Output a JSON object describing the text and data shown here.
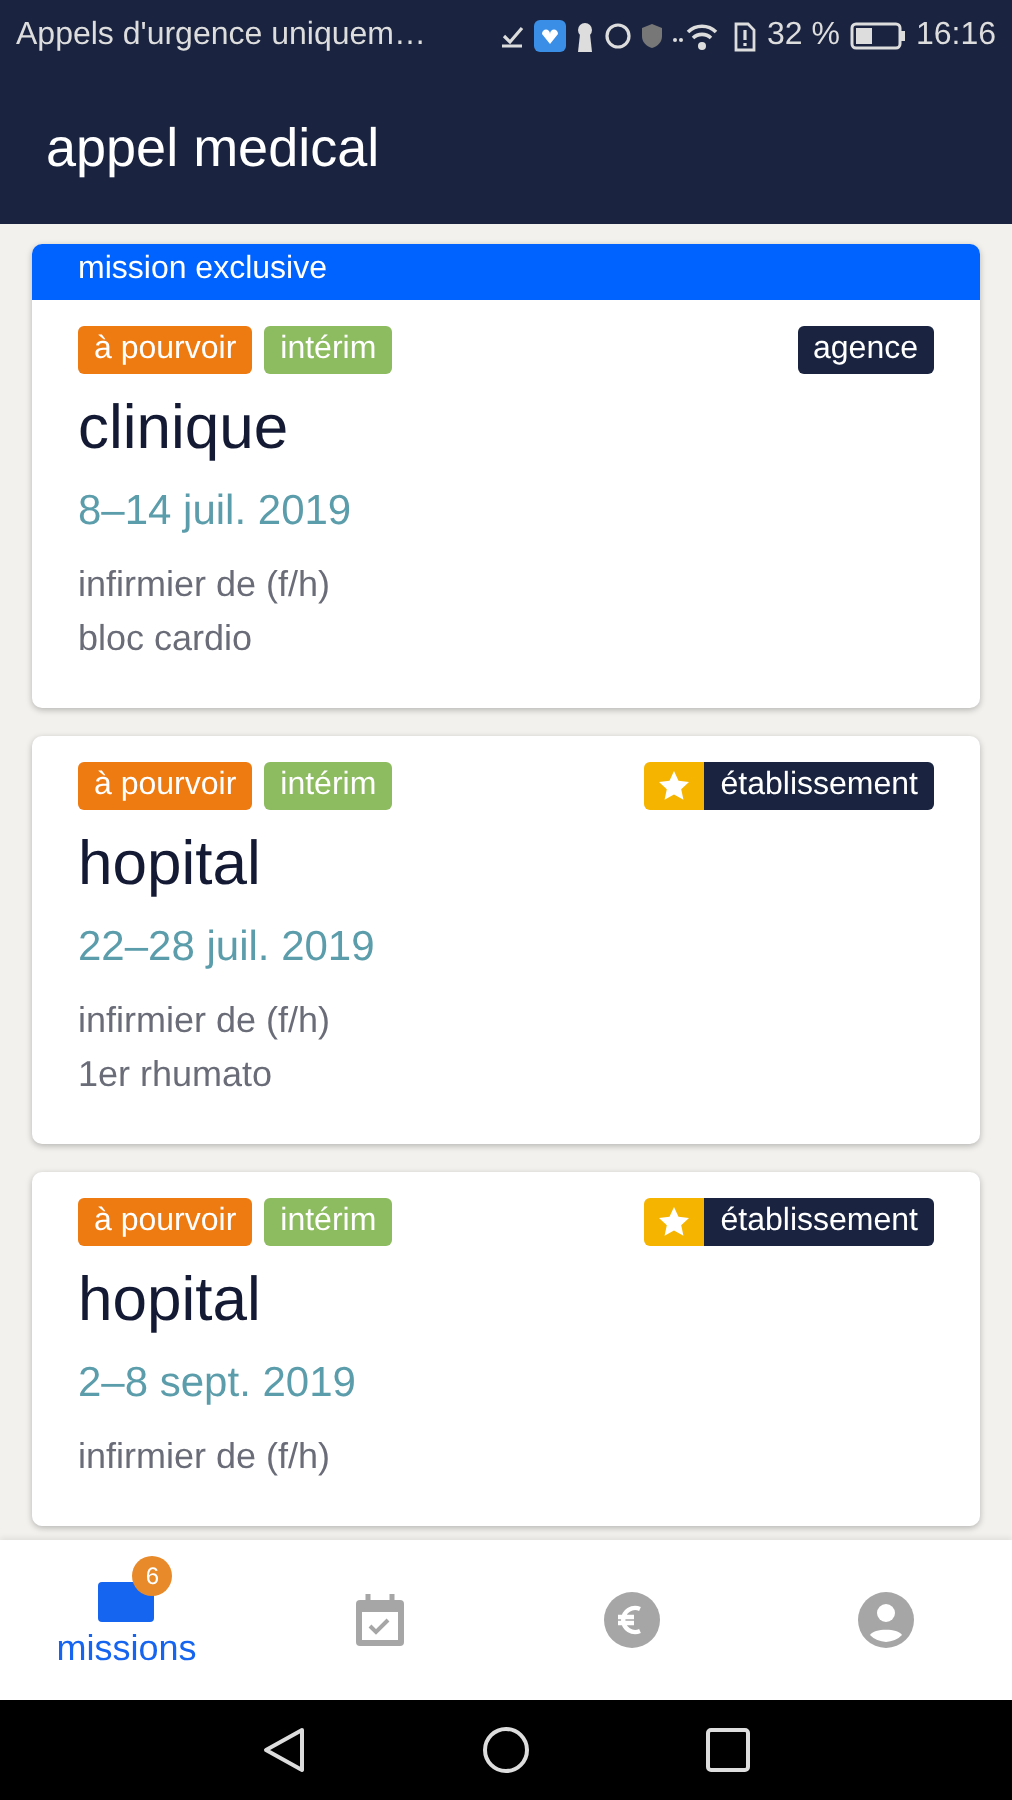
{
  "status_bar": {
    "notice": "Appels d'urgence uniquem…",
    "battery": "32 %",
    "time": "16:16"
  },
  "app_bar": {
    "title": "appel medical"
  },
  "missions": [
    {
      "banner": "mission exclusive",
      "tags": [
        {
          "label": "à pourvoir",
          "color": "#ee7a12"
        },
        {
          "label": "intérim",
          "color": "#8dbb5f"
        }
      ],
      "badge": {
        "label": "agence",
        "starred": false
      },
      "place": "clinique",
      "dates": "8–14 juil. 2019",
      "role": "infirmier de (f/h)",
      "unit": "bloc cardio"
    },
    {
      "tags": [
        {
          "label": "à pourvoir",
          "color": "#ee7a12"
        },
        {
          "label": "intérim",
          "color": "#8dbb5f"
        }
      ],
      "badge": {
        "label": "établissement",
        "starred": true
      },
      "place": "hopital",
      "dates": "22–28 juil. 2019",
      "role": "infirmier de (f/h)",
      "unit": "1er rhumato"
    },
    {
      "tags": [
        {
          "label": "à pourvoir",
          "color": "#ee7a12"
        },
        {
          "label": "intérim",
          "color": "#8dbb5f"
        }
      ],
      "badge": {
        "label": "établissement",
        "starred": true
      },
      "place": "hopital",
      "dates": "2–8 sept. 2019",
      "role": "infirmier de (f/h)"
    }
  ],
  "bottom_nav": [
    {
      "kind": "missions",
      "label": "missions",
      "count": "6",
      "selected": true
    },
    {
      "kind": "calendar",
      "selected": false
    },
    {
      "kind": "payment",
      "selected": false
    },
    {
      "kind": "profile",
      "selected": false
    }
  ]
}
